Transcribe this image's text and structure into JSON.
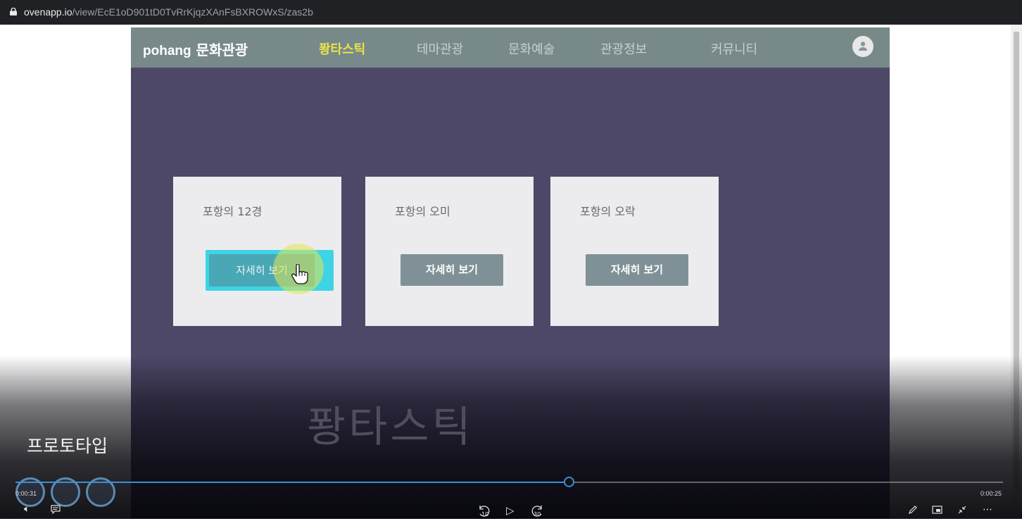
{
  "browser": {
    "url_host": "ovenapp.io",
    "url_path": "/view/EcE1oD901tD0TvRrKjqzXAnFsBXROWxS/zas2b"
  },
  "site": {
    "brand_en": "pohang",
    "brand_ko": "문화관광",
    "menu": [
      {
        "label": "퐝타스틱",
        "active": true
      },
      {
        "label": "테마관광",
        "active": false
      },
      {
        "label": "문화예술",
        "active": false
      },
      {
        "label": "관광정보",
        "active": false
      },
      {
        "label": "커뮤니티",
        "active": false
      }
    ],
    "cards": [
      {
        "title": "포항의 12경",
        "button": "자세히 보기"
      },
      {
        "title": "포항의 오미",
        "button": "자세히 보기"
      },
      {
        "title": "포항의 오락",
        "button": "자세히 보기"
      }
    ],
    "big_title": "퐝타스틱"
  },
  "player": {
    "caption": "프로토타입",
    "time_elapsed": "0:00:31",
    "time_remaining": "0:00:25",
    "progress": 0.56,
    "skip_back": "10",
    "skip_forward": "30"
  },
  "colors": {
    "nav_bg": "#78898a",
    "stage_bg": "#4d4868",
    "active_menu": "#e8e14a",
    "progress": "#3a8fd8"
  }
}
